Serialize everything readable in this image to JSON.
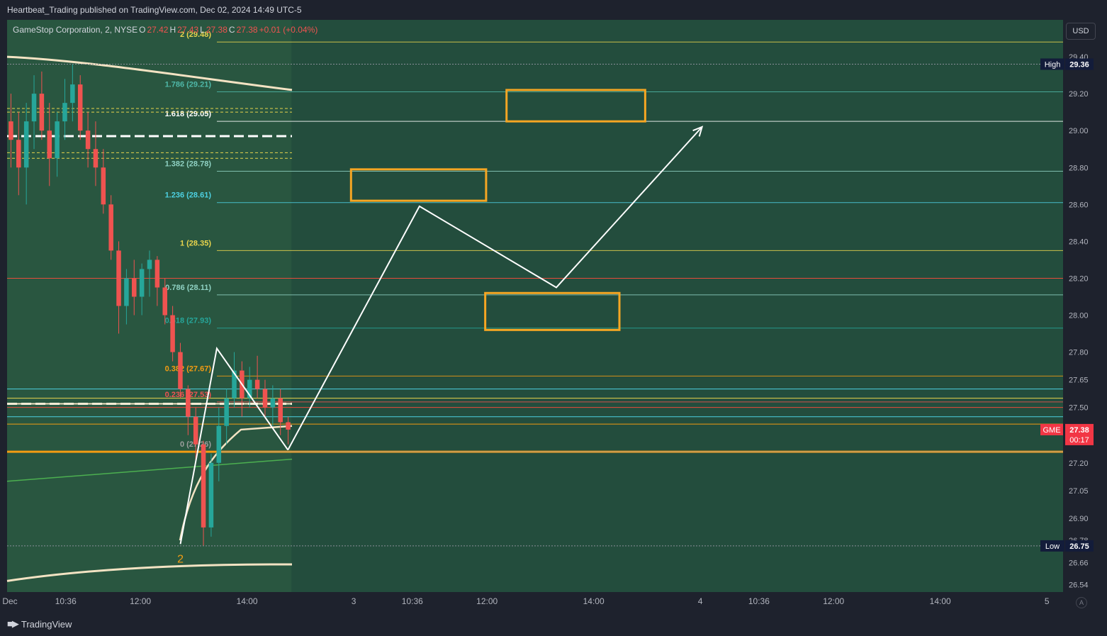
{
  "publisher": "Heartbeat_Trading published on TradingView.com, Dec 02, 2024 14:49 UTC-5",
  "brand": "TradingView",
  "currency_button": "USD",
  "auto_button": "A",
  "legend": {
    "symbol": "GameStop Corporation, 2, NYSE",
    "o_label": "O",
    "o_value": "27.42",
    "h_label": "H",
    "h_value": "27.43",
    "l_label": "L",
    "l_value": "27.38",
    "c_label": "C",
    "c_value": "27.38",
    "change": "+0.01 (+0.04%)"
  },
  "colors": {
    "background": "#234d3d",
    "up": "#26a69a",
    "down": "#ef5350",
    "fib_yellow": "#e8d44d",
    "fib_teal": "#4fb8a8",
    "fib_cyan": "#4dd0e1",
    "fib_orange": "#f39c12",
    "target_box": "#f5a623",
    "path": "#ffffff",
    "ma": "#f3e3c3",
    "red_line": "#e74c3c",
    "price_tag": "#f23645",
    "extreme_tag": "#131c3a"
  },
  "chart_data": {
    "type": "candlestick",
    "symbol": "GME",
    "timeframe": "2",
    "ylim": [
      26.5,
      29.6
    ],
    "y_ticks": [
      29.4,
      29.2,
      29.0,
      28.8,
      28.6,
      28.4,
      28.2,
      28.0,
      27.8,
      27.65,
      27.5,
      27.2,
      27.05,
      26.9,
      26.78,
      26.66,
      26.54
    ],
    "x_ticks": [
      {
        "label": "Dec",
        "t": 0
      },
      {
        "label": "10:36",
        "t": 66
      },
      {
        "label": "12:00",
        "t": 150
      },
      {
        "label": "14:00",
        "t": 270
      },
      {
        "label": "3",
        "t": 390
      },
      {
        "label": "10:36",
        "t": 456
      },
      {
        "label": "12:00",
        "t": 540
      },
      {
        "label": "14:00",
        "t": 660
      },
      {
        "label": "4",
        "t": 780
      },
      {
        "label": "10:36",
        "t": 846
      },
      {
        "label": "12:00",
        "t": 930
      },
      {
        "label": "14:00",
        "t": 1050
      },
      {
        "label": "5",
        "t": 1170
      }
    ],
    "fib_levels": [
      {
        "ratio": "2",
        "price": 29.48,
        "label": "2 (29.48)",
        "color": "#e8d44d"
      },
      {
        "ratio": "1.786",
        "price": 29.21,
        "label": "1.786 (29.21)",
        "color": "#4fb8a8"
      },
      {
        "ratio": "1.618",
        "price": 29.05,
        "label": "1.618 (29.05)",
        "color": "#ffffff"
      },
      {
        "ratio": "1.382",
        "price": 28.78,
        "label": "1.382 (28.78)",
        "color": "#8fd1c2"
      },
      {
        "ratio": "1.236",
        "price": 28.61,
        "label": "1.236 (28.61)",
        "color": "#4dd0e1"
      },
      {
        "ratio": "1",
        "price": 28.35,
        "label": "1 (28.35)",
        "color": "#e8d44d"
      },
      {
        "ratio": "0.786",
        "price": 28.11,
        "label": "0.786 (28.11)",
        "color": "#8fd1c2"
      },
      {
        "ratio": "0.618",
        "price": 27.93,
        "label": "0.618 (27.93)",
        "color": "#26a69a"
      },
      {
        "ratio": "0.382",
        "price": 27.67,
        "label": "0.382 (27.67)",
        "color": "#f39c12"
      },
      {
        "ratio": "0.236",
        "price": 27.53,
        "label": "0.236 (27.53)",
        "color": "#ef5350"
      },
      {
        "ratio": "0",
        "price": 27.26,
        "label": "0 (27.26)",
        "color": "#9e9e9e"
      }
    ],
    "target_boxes": [
      {
        "name": "target-box-upper",
        "t0": 562,
        "t1": 718,
        "p_top": 29.22,
        "p_bottom": 29.05
      },
      {
        "name": "target-box-middle",
        "t0": 387,
        "t1": 539,
        "p_top": 28.79,
        "p_bottom": 28.62
      },
      {
        "name": "target-box-lower",
        "t0": 538,
        "t1": 689,
        "p_top": 28.12,
        "p_bottom": 27.92
      }
    ],
    "projection_path": [
      {
        "t": 316,
        "p": 27.27
      },
      {
        "t": 464,
        "p": 28.59
      },
      {
        "t": 618,
        "p": 28.15
      },
      {
        "t": 782,
        "p": 29.02
      }
    ],
    "wave_path": [
      {
        "t": 195,
        "p": 26.76
      },
      {
        "t": 236,
        "p": 27.82
      },
      {
        "t": 316,
        "p": 27.27
      }
    ],
    "wave_label": "2",
    "horizontal_lines": [
      {
        "price": 28.2,
        "color": "#e74c3c"
      },
      {
        "price": 27.6,
        "color": "#4dd0e1"
      },
      {
        "price": 27.55,
        "color": "#e8d44d"
      },
      {
        "price": 27.5,
        "color": "#e74c3c"
      },
      {
        "price": 27.45,
        "color": "#4dd0e1"
      },
      {
        "price": 27.41,
        "color": "#f39c12"
      },
      {
        "price": 27.26,
        "color": "#f39c12"
      }
    ],
    "high": {
      "label": "High",
      "value": "29.36",
      "price": 29.36
    },
    "low": {
      "label": "Low",
      "value": "26.75",
      "price": 26.75
    },
    "last": {
      "symbol": "GME",
      "price": "27.38",
      "countdown": "00:17",
      "value": 27.38
    },
    "candles": [
      {
        "o": 29.05,
        "h": 29.2,
        "l": 28.8,
        "c": 28.95
      },
      {
        "o": 28.95,
        "h": 29.1,
        "l": 28.65,
        "c": 28.8
      },
      {
        "o": 28.8,
        "h": 29.15,
        "l": 28.6,
        "c": 29.05
      },
      {
        "o": 29.05,
        "h": 29.3,
        "l": 28.9,
        "c": 29.2
      },
      {
        "o": 29.2,
        "h": 29.32,
        "l": 28.95,
        "c": 29.0
      },
      {
        "o": 29.0,
        "h": 29.15,
        "l": 28.7,
        "c": 28.85
      },
      {
        "o": 28.85,
        "h": 29.1,
        "l": 28.75,
        "c": 29.05
      },
      {
        "o": 29.05,
        "h": 29.28,
        "l": 28.95,
        "c": 29.15
      },
      {
        "o": 29.15,
        "h": 29.36,
        "l": 29.05,
        "c": 29.25
      },
      {
        "o": 29.25,
        "h": 29.3,
        "l": 28.95,
        "c": 29.0
      },
      {
        "o": 29.0,
        "h": 29.1,
        "l": 28.8,
        "c": 28.9
      },
      {
        "o": 28.9,
        "h": 29.05,
        "l": 28.7,
        "c": 28.8
      },
      {
        "o": 28.8,
        "h": 28.9,
        "l": 28.55,
        "c": 28.6
      },
      {
        "o": 28.6,
        "h": 28.65,
        "l": 28.3,
        "c": 28.35
      },
      {
        "o": 28.35,
        "h": 28.4,
        "l": 27.9,
        "c": 28.05
      },
      {
        "o": 28.05,
        "h": 28.25,
        "l": 27.95,
        "c": 28.2
      },
      {
        "o": 28.2,
        "h": 28.3,
        "l": 28.0,
        "c": 28.1
      },
      {
        "o": 28.1,
        "h": 28.28,
        "l": 28.0,
        "c": 28.25
      },
      {
        "o": 28.25,
        "h": 28.35,
        "l": 28.1,
        "c": 28.3
      },
      {
        "o": 28.3,
        "h": 28.32,
        "l": 28.05,
        "c": 28.15
      },
      {
        "o": 28.15,
        "h": 28.2,
        "l": 27.95,
        "c": 28.0
      },
      {
        "o": 28.0,
        "h": 28.05,
        "l": 27.75,
        "c": 27.8
      },
      {
        "o": 27.8,
        "h": 27.85,
        "l": 27.55,
        "c": 27.6
      },
      {
        "o": 27.6,
        "h": 27.62,
        "l": 27.35,
        "c": 27.45
      },
      {
        "o": 27.45,
        "h": 27.5,
        "l": 27.2,
        "c": 27.3
      },
      {
        "o": 27.3,
        "h": 27.32,
        "l": 26.75,
        "c": 26.85
      },
      {
        "o": 26.85,
        "h": 27.25,
        "l": 26.8,
        "c": 27.2
      },
      {
        "o": 27.2,
        "h": 27.5,
        "l": 27.1,
        "c": 27.4
      },
      {
        "o": 27.4,
        "h": 27.6,
        "l": 27.3,
        "c": 27.55
      },
      {
        "o": 27.55,
        "h": 27.8,
        "l": 27.5,
        "c": 27.7
      },
      {
        "o": 27.7,
        "h": 27.75,
        "l": 27.45,
        "c": 27.55
      },
      {
        "o": 27.55,
        "h": 27.72,
        "l": 27.5,
        "c": 27.65
      },
      {
        "o": 27.65,
        "h": 27.78,
        "l": 27.55,
        "c": 27.6
      },
      {
        "o": 27.6,
        "h": 27.65,
        "l": 27.45,
        "c": 27.5
      },
      {
        "o": 27.5,
        "h": 27.62,
        "l": 27.4,
        "c": 27.55
      },
      {
        "o": 27.55,
        "h": 27.6,
        "l": 27.35,
        "c": 27.42
      },
      {
        "o": 27.42,
        "h": 27.45,
        "l": 27.3,
        "c": 27.38
      }
    ]
  }
}
